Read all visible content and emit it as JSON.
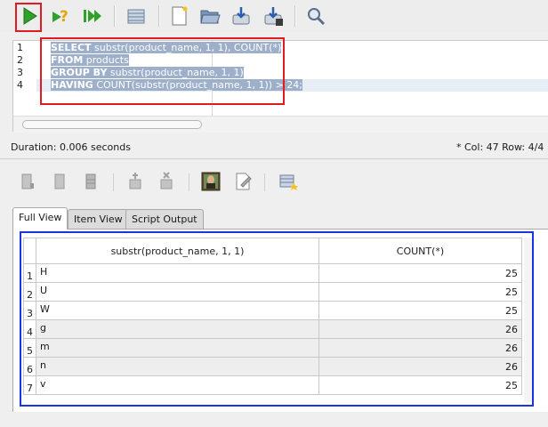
{
  "toolbar": {
    "buttons": [
      {
        "icon": "run-statement-icon",
        "title": "Run Statement"
      },
      {
        "icon": "explain-plan-icon",
        "title": "Explain Plan"
      },
      {
        "icon": "run-script-icon",
        "title": "Run Script"
      },
      {
        "icon": "sql-history-icon",
        "title": "SQL History"
      },
      {
        "icon": "new-file-icon",
        "title": "New"
      },
      {
        "icon": "open-file-icon",
        "title": "Open"
      },
      {
        "icon": "save-icon",
        "title": "Save"
      },
      {
        "icon": "save-as-icon",
        "title": "Save As"
      },
      {
        "icon": "find-icon",
        "title": "Find"
      }
    ]
  },
  "editor": {
    "line_numbers": [
      "1",
      "2",
      "3",
      "4"
    ],
    "lines": [
      {
        "keyword": "SELECT",
        "rest": " substr(product_name, 1, 1), COUNT(*)"
      },
      {
        "keyword": "FROM",
        "rest": " products"
      },
      {
        "keyword": "GROUP BY",
        "rest": " substr(product_name, 1, 1)"
      },
      {
        "keyword": "HAVING",
        "rest": " COUNT(substr(product_name, 1, 1)) > 24;"
      }
    ]
  },
  "status": {
    "duration": "Duration: 0.006 seconds",
    "cursor": "*  Col: 47 Row: 4/4"
  },
  "results_toolbar": {
    "buttons": [
      "first-row-icon",
      "previous-row-icon",
      "last-row-icon",
      "insert-row-icon",
      "delete-row-icon",
      "image-viewer-icon",
      "edit-icon",
      "export-icon"
    ]
  },
  "tabs": [
    {
      "label": "Full View",
      "active": true
    },
    {
      "label": "Item View",
      "active": false
    },
    {
      "label": "Script Output",
      "active": false
    }
  ],
  "grid": {
    "columns": [
      "substr(product_name, 1, 1)",
      "COUNT(*)"
    ],
    "rows": [
      {
        "n": "1",
        "letter": "H",
        "count": "25"
      },
      {
        "n": "2",
        "letter": "U",
        "count": "25"
      },
      {
        "n": "3",
        "letter": "W",
        "count": "25"
      },
      {
        "n": "4",
        "letter": "g",
        "count": "26"
      },
      {
        "n": "5",
        "letter": "m",
        "count": "26"
      },
      {
        "n": "6",
        "letter": "n",
        "count": "26"
      },
      {
        "n": "7",
        "letter": "v",
        "count": "25"
      }
    ]
  },
  "colors": {
    "annotation_red": "#e01b24",
    "annotation_blue": "#1a34e0",
    "selection": "#9dafc9"
  }
}
